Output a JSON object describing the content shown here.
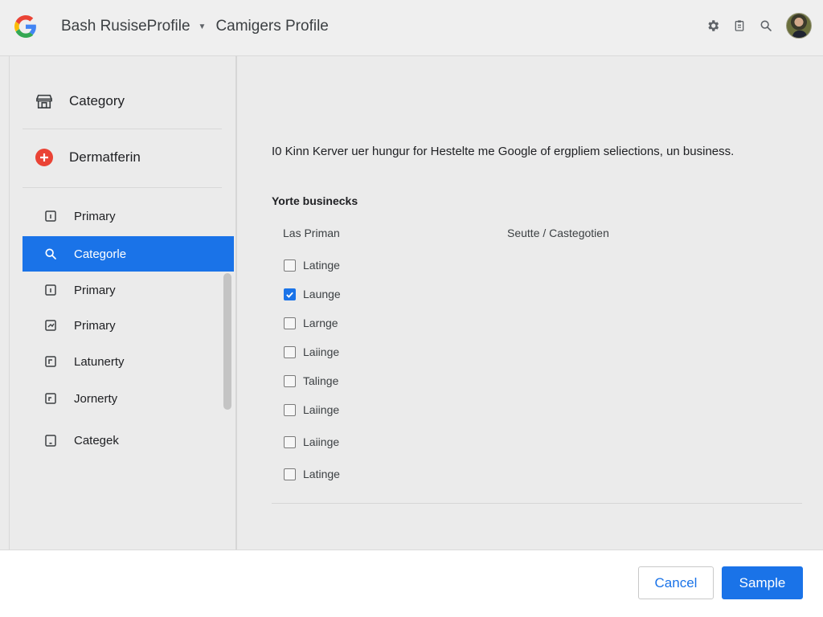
{
  "colors": {
    "accent": "#1a73e8",
    "google_red": "#ea4335"
  },
  "header": {
    "logo_icon": "google-g-icon",
    "breadcrumb": [
      "Bash RusiseProfile",
      "Camigers Profile"
    ],
    "icons": [
      "settings-icon",
      "clipboard-icon",
      "search-icon"
    ]
  },
  "sidebar": {
    "top_items": [
      {
        "label": "Category",
        "icon": "store-icon"
      },
      {
        "label": "Dermatferin",
        "icon": "add-circle-icon"
      }
    ],
    "items": [
      {
        "label": "Primary",
        "icon": "square-icon"
      },
      {
        "label": "Categorle",
        "icon": "search-icon",
        "active": true
      },
      {
        "label": "Primary",
        "icon": "square-icon"
      },
      {
        "label": "Primary",
        "icon": "chart-box-icon"
      },
      {
        "label": "Latunerty",
        "icon": "square-icon"
      },
      {
        "label": "Jornerty",
        "icon": "square-icon"
      },
      {
        "label": "Categek",
        "icon": "tablet-icon"
      }
    ]
  },
  "main": {
    "description": "I0 Kinn Kerver uer hungur for Hestelte me Google of ergpliem seliections, un business.",
    "section_title": "Yorte businecks",
    "columns": [
      "Las Priman",
      "Seutte / Castegotien"
    ],
    "options": [
      {
        "label": "Latinge",
        "checked": false
      },
      {
        "label": "Launge",
        "checked": true
      },
      {
        "label": "Larnge",
        "checked": false
      },
      {
        "label": "Laiinge",
        "checked": false
      },
      {
        "label": "Talinge",
        "checked": false
      },
      {
        "label": "Laiinge",
        "checked": false
      },
      {
        "label": "Laiinge",
        "checked": false
      },
      {
        "label": "Latinge",
        "checked": false
      }
    ]
  },
  "footer": {
    "cancel_label": "Cancel",
    "primary_label": "Sample"
  }
}
